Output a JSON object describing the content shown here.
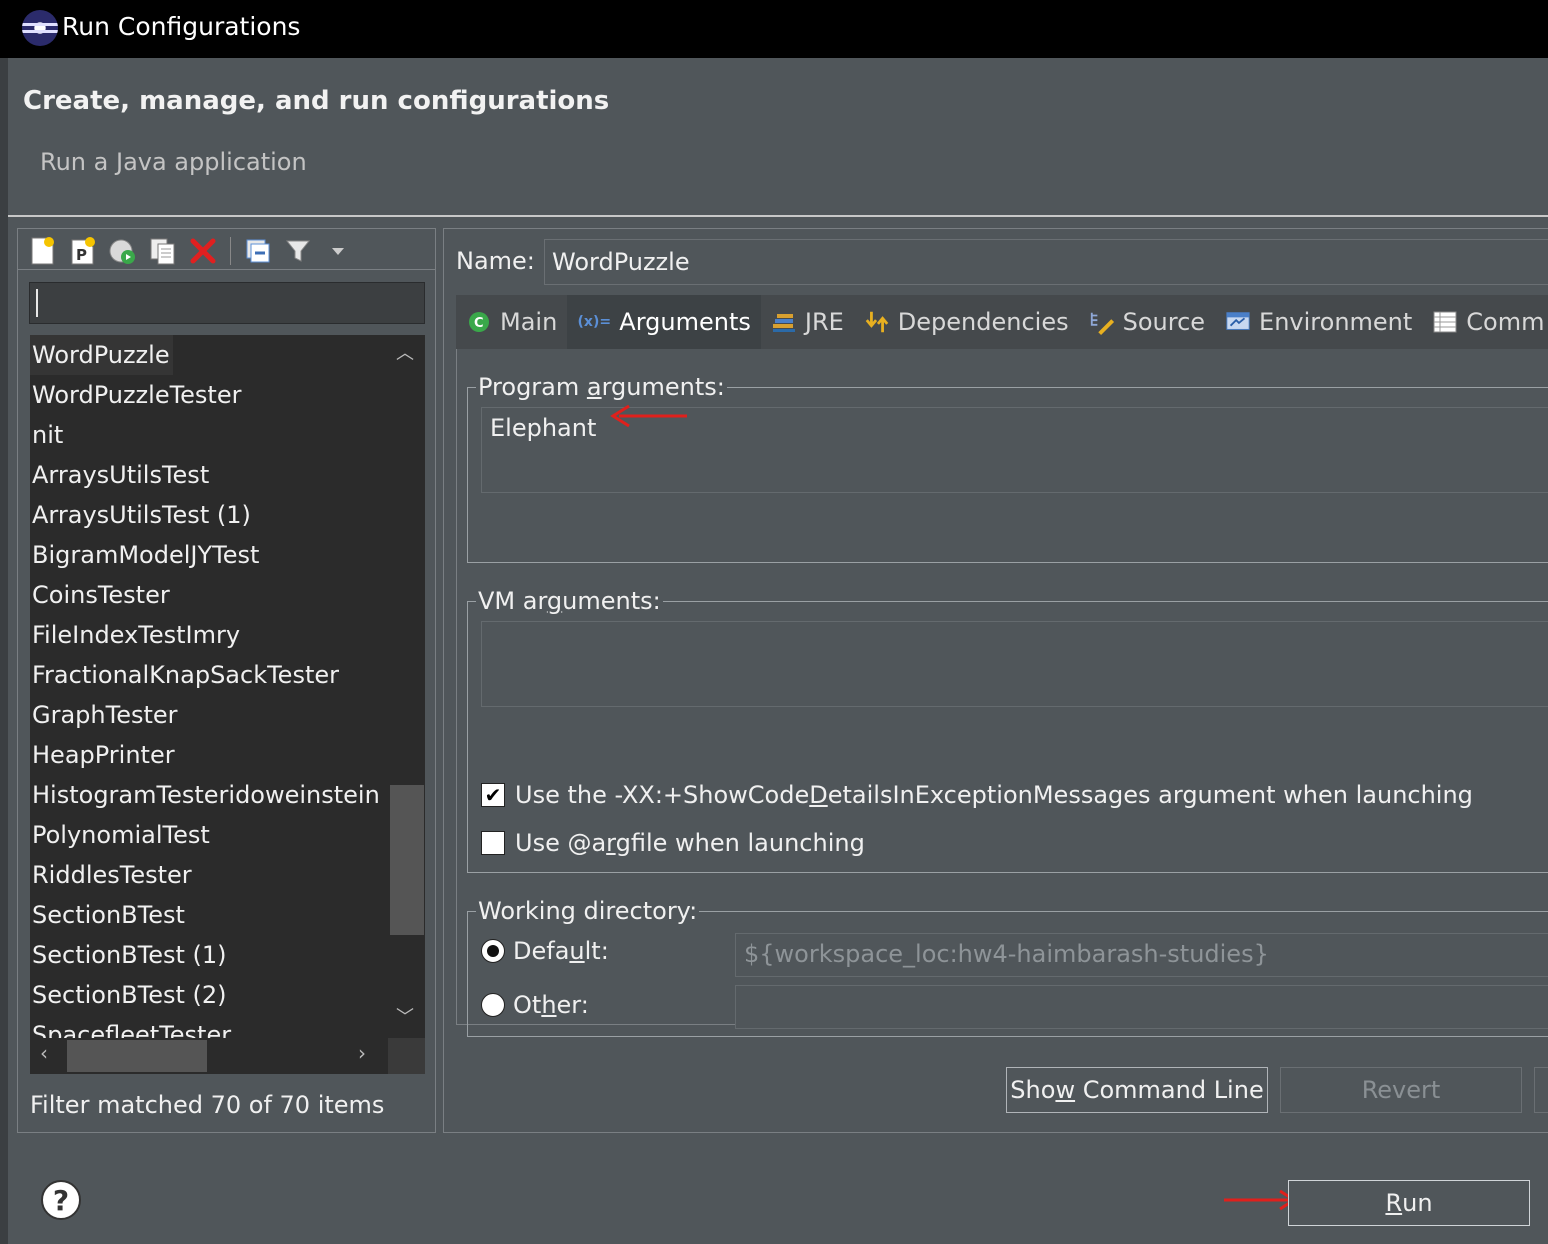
{
  "window": {
    "title": "Run Configurations"
  },
  "header": {
    "title": "Create, manage, and run configurations",
    "subtitle": "Run a Java application"
  },
  "left_panel": {
    "toolbar": [
      {
        "name": "new-launch-configuration-icon"
      },
      {
        "name": "new-prototype-icon"
      },
      {
        "name": "export-icon"
      },
      {
        "name": "duplicate-icon"
      },
      {
        "name": "delete-icon"
      },
      {
        "name": "collapse-all-icon"
      },
      {
        "name": "filter-icon"
      },
      {
        "name": "view-menu-icon"
      }
    ],
    "filter_value": "",
    "items": [
      "WordPuzzle",
      "WordPuzzleTester",
      "nit",
      "ArraysUtilsTest",
      "ArraysUtilsTest (1)",
      "BigramModelJYTest",
      "CoinsTester",
      "FileIndexTestImry",
      "FractionalKnapSackTester",
      "GraphTester",
      "HeapPrinter",
      "HistogramTesteridoweinstein",
      "PolynomialTest",
      "RiddlesTester",
      "SectionBTest",
      "SectionBTest (1)",
      "SectionBTest (2)",
      "SpacefleetTester"
    ],
    "selected_index": 0,
    "filter_status": "Filter matched 70 of 70 items"
  },
  "config": {
    "name_label": "Name:",
    "name_value": "WordPuzzle",
    "tabs": [
      {
        "label": "Main",
        "icon": "main-class-icon"
      },
      {
        "label": "Arguments",
        "icon": "arguments-icon"
      },
      {
        "label": "JRE",
        "icon": "jre-icon"
      },
      {
        "label": "Dependencies",
        "icon": "dependencies-icon"
      },
      {
        "label": "Source",
        "icon": "source-icon"
      },
      {
        "label": "Environment",
        "icon": "environment-icon"
      },
      {
        "label": "Comm",
        "icon": "common-icon"
      }
    ],
    "active_tab": "Arguments",
    "program_args_label": "Program arguments:",
    "program_args_value": "Elephant",
    "vm_args_label": "VM arguments:",
    "vm_args_value": "",
    "checkbox_showcode": "Use the -XX:+ShowCodeDetailsInExceptionMessages argument when launching",
    "checkbox_showcode_checked": true,
    "checkbox_argfile": "Use @argfile when launching",
    "checkbox_argfile_checked": false,
    "working_dir_label": "Working directory:",
    "radio_default": "Default:",
    "radio_default_value": "${workspace_loc:hw4-haimbarash-studies}",
    "radio_other": "Other:",
    "radio_selected": "Default"
  },
  "buttons": {
    "show_command_line": "Show Command Line",
    "revert": "Revert",
    "run": "Run"
  },
  "colors": {
    "background": "#50565a",
    "annotation_arrow": "#e0201c"
  }
}
